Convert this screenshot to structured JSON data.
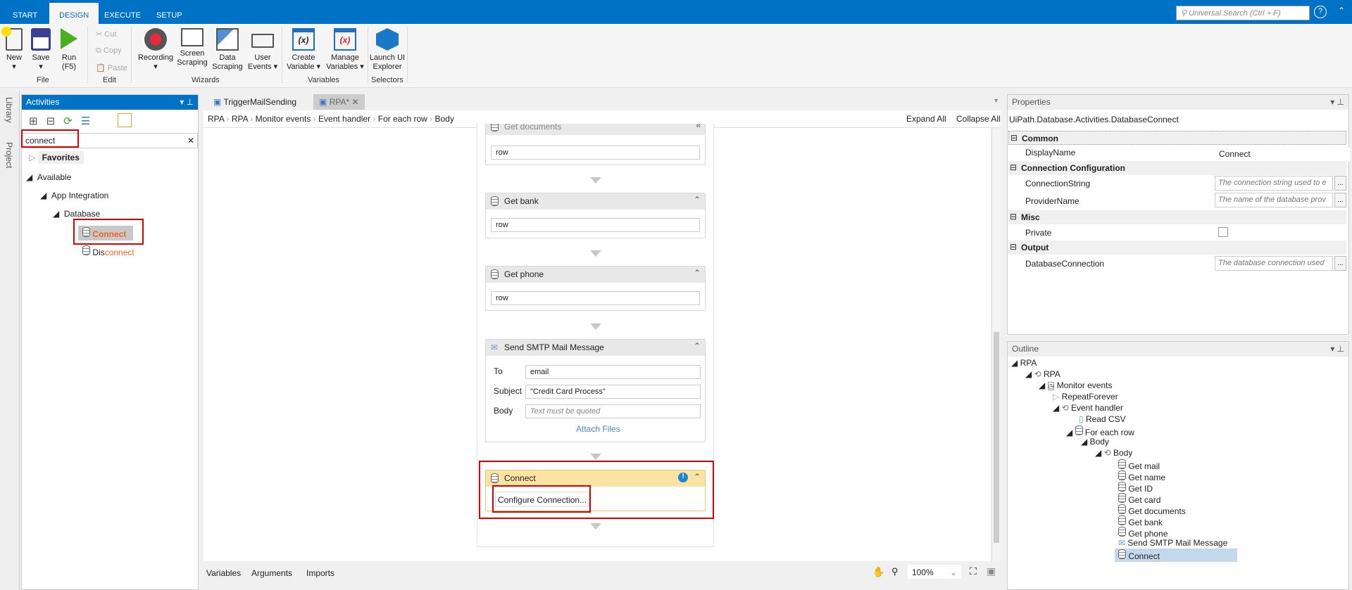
{
  "ribbon_tabs": [
    "START",
    "DESIGN",
    "EXECUTE",
    "SETUP"
  ],
  "universal_search_placeholder": "Universal Search (Ctrl + F)",
  "ribbon": {
    "new": "New",
    "save": "Save",
    "run": "Run",
    "run_key": "(F5)",
    "file_group": "File",
    "cut": "Cut",
    "copy": "Copy",
    "paste": "Paste",
    "edit_group": "Edit",
    "recording": "Recording",
    "screen_scraping": [
      "Screen",
      "Scraping"
    ],
    "data_scraping": [
      "Data",
      "Scraping"
    ],
    "user_events": [
      "User",
      "Events"
    ],
    "wizards_group": "Wizards",
    "create_variable": [
      "Create",
      "Variable"
    ],
    "manage_variables": [
      "Manage",
      "Variables"
    ],
    "variables_group": "Variables",
    "launch_ui_explorer": [
      "Launch UI",
      "Explorer"
    ],
    "selectors_group": "Selectors"
  },
  "side_tabs": [
    "Library",
    "Project"
  ],
  "activities": {
    "title": "Activities",
    "search_value": "connect",
    "tree": [
      "Favorites",
      "Available",
      "App Integration",
      "Database",
      "Connect",
      "Dis",
      "connect"
    ]
  },
  "doc_tabs": [
    "TriggerMailSending",
    "RPA*"
  ],
  "breadcrumb": [
    "RPA",
    "RPA",
    "Monitor events",
    "Event handler",
    "For each row",
    "Body"
  ],
  "expand_all": "Expand All",
  "collapse_all": "Collapse All",
  "cards": {
    "get_documents": {
      "title": "Get documents",
      "value": "row"
    },
    "get_bank": {
      "title": "Get bank",
      "value": "row"
    },
    "get_phone": {
      "title": "Get phone",
      "value": "row"
    },
    "smtp": {
      "title": "Send SMTP Mail Message",
      "to_label": "To",
      "to": "email",
      "subject_label": "Subject",
      "subject": "\"Credit Card Process\"",
      "body_label": "Body",
      "body_placeholder": "Text must be quoted",
      "attach": "Attach Files"
    },
    "connect": {
      "title": "Connect",
      "button": "Configure Connection..."
    }
  },
  "bottom": {
    "tabs": [
      "Variables",
      "Arguments",
      "Imports"
    ],
    "zoom": "100%"
  },
  "properties": {
    "title": "Properties",
    "type": "UiPath.Database.Activities.DatabaseConnect",
    "categories": [
      "Common",
      "Connection Configuration",
      "Misc",
      "Output"
    ],
    "display_name_label": "DisplayName",
    "display_name": "Connect",
    "connection_string_label": "ConnectionString",
    "connection_string_placeholder": "The connection string used to e",
    "provider_label": "ProviderName",
    "provider_placeholder": "The name of the database prov",
    "private_label": "Private",
    "private_checked": false,
    "db_conn_label": "DatabaseConnection",
    "db_conn_placeholder": "The database connection used",
    "ellipsis": "..."
  },
  "outline": {
    "title": "Outline",
    "items": [
      "RPA",
      "RPA",
      "Monitor events",
      "RepeatForever",
      "Event handler",
      "Read CSV",
      "For each row",
      "Body",
      "Body",
      "Get mail",
      "Get name",
      "Get ID",
      "Get card",
      "Get documents",
      "Get bank",
      "Get phone",
      "Send SMTP Mail Message",
      "Connect"
    ]
  },
  "colors": {
    "accent": "#0072c6",
    "highlight_red": "#e00000",
    "search_match": "#f26522",
    "connect_header": "#fbe3a4"
  }
}
